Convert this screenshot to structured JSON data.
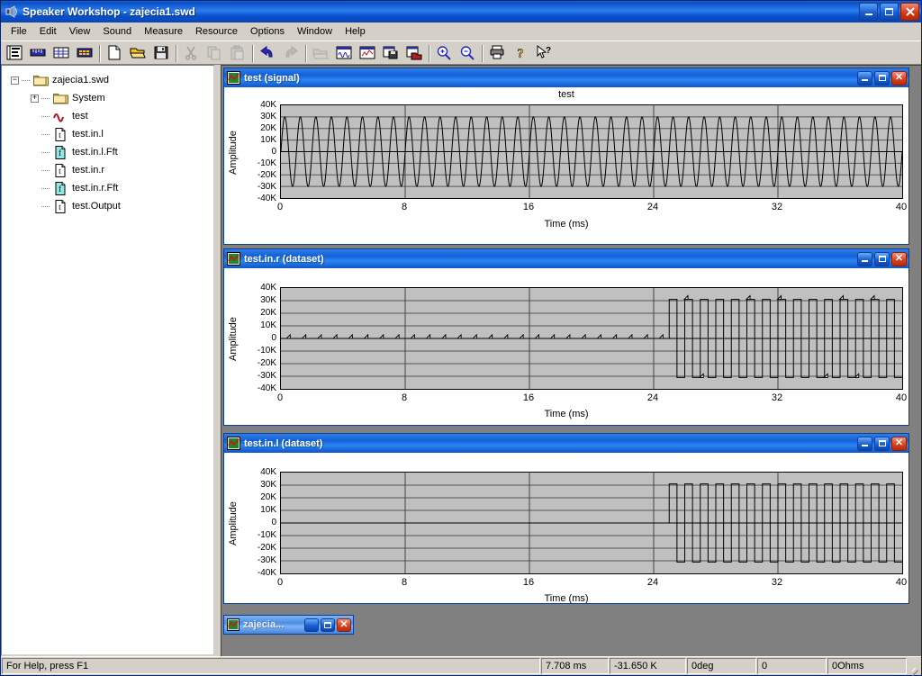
{
  "window": {
    "title": "Speaker Workshop - zajecia1.swd",
    "app_icon": "speaker-icon",
    "buttons": {
      "minimize": "minimize",
      "maximize": "maximize",
      "close": "close"
    }
  },
  "menu": {
    "items": [
      "File",
      "Edit",
      "View",
      "Sound",
      "Measure",
      "Resource",
      "Options",
      "Window",
      "Help"
    ]
  },
  "toolbar": {
    "groups": [
      {
        "buttons": [
          {
            "name": "project-view-icon",
            "enabled": true
          },
          {
            "name": "ruler-icon",
            "enabled": true
          },
          {
            "name": "grid-icon",
            "enabled": true
          },
          {
            "name": "keypad-icon",
            "enabled": true
          }
        ]
      },
      {
        "buttons": [
          {
            "name": "new-file-icon",
            "enabled": true
          },
          {
            "name": "open-folder-icon",
            "enabled": true
          },
          {
            "name": "save-disk-icon",
            "enabled": true
          }
        ]
      },
      {
        "buttons": [
          {
            "name": "cut-scissors-icon",
            "enabled": false
          },
          {
            "name": "copy-icon",
            "enabled": false
          },
          {
            "name": "paste-icon",
            "enabled": false
          }
        ]
      },
      {
        "buttons": [
          {
            "name": "undo-arrow-icon",
            "enabled": true
          },
          {
            "name": "redo-arrow-icon",
            "enabled": false
          }
        ]
      },
      {
        "buttons": [
          {
            "name": "import-icon",
            "enabled": false
          },
          {
            "name": "signal-window-icon",
            "enabled": true
          },
          {
            "name": "chart-window-icon",
            "enabled": true
          },
          {
            "name": "save-data-icon",
            "enabled": true
          },
          {
            "name": "load-data-icon",
            "enabled": true
          }
        ]
      },
      {
        "buttons": [
          {
            "name": "zoom-in-icon",
            "enabled": true
          },
          {
            "name": "zoom-out-icon",
            "enabled": true
          }
        ]
      },
      {
        "buttons": [
          {
            "name": "print-icon",
            "enabled": true
          },
          {
            "name": "help-question-icon",
            "enabled": true
          },
          {
            "name": "context-help-icon",
            "enabled": true
          }
        ]
      }
    ]
  },
  "tree": {
    "nodes": [
      {
        "label": "zajecia1.swd",
        "depth": 0,
        "expander": "-",
        "icon": "folder-open-icon"
      },
      {
        "label": "System",
        "depth": 1,
        "expander": "+",
        "icon": "folder-icon"
      },
      {
        "label": "test",
        "depth": 1,
        "expander": "",
        "icon": "waveform-icon"
      },
      {
        "label": "test.in.l",
        "depth": 1,
        "expander": "",
        "icon": "t-document-icon"
      },
      {
        "label": "test.in.l.Fft",
        "depth": 1,
        "expander": "",
        "icon": "f-document-icon"
      },
      {
        "label": "test.in.r",
        "depth": 1,
        "expander": "",
        "icon": "t-document-icon"
      },
      {
        "label": "test.in.r.Fft",
        "depth": 1,
        "expander": "",
        "icon": "f-document-icon"
      },
      {
        "label": "test.Output",
        "depth": 1,
        "expander": "",
        "icon": "t-document-icon"
      }
    ]
  },
  "mdi_windows": [
    {
      "title": "test (signal)",
      "icon": "chart-doc-icon",
      "buttons": {
        "minimize": "minimize",
        "maximize": "maximize",
        "close": "close"
      }
    },
    {
      "title": "test.in.r (dataset)",
      "icon": "chart-doc-icon",
      "buttons": {
        "minimize": "minimize",
        "maximize": "maximize",
        "close": "close"
      }
    },
    {
      "title": "test.in.l (dataset)",
      "icon": "chart-doc-icon",
      "buttons": {
        "minimize": "minimize",
        "maximize": "maximize",
        "close": "close"
      }
    }
  ],
  "minimized_window": {
    "title": "zajecia...",
    "icon": "chart-doc-icon",
    "buttons": {
      "restore": "restore",
      "maximize": "maximize",
      "close": "close"
    }
  },
  "statusbar": {
    "help_text": "For Help, press F1",
    "panels": [
      "7.708  ms",
      "-31.650 K",
      "0deg",
      "0",
      "0Ohms"
    ]
  },
  "chart_data": [
    {
      "type": "line",
      "title": "test",
      "xlabel": "Time (ms)",
      "ylabel": "Amplitude",
      "xticks": [
        0,
        8,
        16,
        24,
        32,
        40
      ],
      "xticklabels": [
        "0",
        "8",
        "16",
        "24",
        "32",
        "40"
      ],
      "yticks": [
        40000,
        30000,
        20000,
        10000,
        0,
        -10000,
        -20000,
        -30000,
        -40000
      ],
      "yticklabels": [
        "40K",
        "30K",
        "20K",
        "10K",
        "0",
        "-10K",
        "-20K",
        "-30K",
        "-40K"
      ],
      "xlim": [
        0,
        40
      ],
      "ylim": [
        -40000,
        40000
      ],
      "grid": true,
      "series": [
        {
          "name": "test",
          "waveform": "sine",
          "frequency_khz": 1.0,
          "amplitude": 30000,
          "offset": 0,
          "start_ms": 0,
          "end_ms": 40,
          "markers": false
        }
      ]
    },
    {
      "type": "line",
      "title": "",
      "xlabel": "Time (ms)",
      "ylabel": "Amplitude",
      "xticks": [
        0,
        8,
        16,
        24,
        32,
        40
      ],
      "xticklabels": [
        "0",
        "8",
        "16",
        "24",
        "32",
        "40"
      ],
      "yticks": [
        40000,
        30000,
        20000,
        10000,
        0,
        -10000,
        -20000,
        -30000,
        -40000
      ],
      "yticklabels": [
        "40K",
        "30K",
        "20K",
        "10K",
        "0",
        "-10K",
        "-20K",
        "-30K",
        "-40K"
      ],
      "xlim": [
        0,
        40
      ],
      "ylim": [
        -40000,
        40000
      ],
      "grid": true,
      "series": [
        {
          "name": "test.in.r",
          "waveform": "silence-then-square",
          "silence_value": 0,
          "silence_start_ms": 0,
          "silence_end_ms": 25,
          "square_start_ms": 25,
          "square_end_ms": 40,
          "frequency_khz": 1.0,
          "amplitude": 31000,
          "markers": true,
          "marker_shape": "diamond",
          "marker_interval_ms": 1.0
        }
      ]
    },
    {
      "type": "line",
      "title": "",
      "xlabel": "Time (ms)",
      "ylabel": "Amplitude",
      "xticks": [
        0,
        8,
        16,
        24,
        32,
        40
      ],
      "xticklabels": [
        "0",
        "8",
        "16",
        "24",
        "32",
        "40"
      ],
      "yticks": [
        40000,
        30000,
        20000,
        10000,
        0,
        -10000,
        -20000,
        -30000,
        -40000
      ],
      "yticklabels": [
        "40K",
        "30K",
        "20K",
        "10K",
        "0",
        "-10K",
        "-20K",
        "-30K",
        "-40K"
      ],
      "xlim": [
        0,
        40
      ],
      "ylim": [
        -40000,
        40000
      ],
      "grid": true,
      "series": [
        {
          "name": "test.in.l",
          "waveform": "silence-then-square",
          "silence_value": 0,
          "silence_start_ms": 0,
          "silence_end_ms": 25,
          "square_start_ms": 25,
          "square_end_ms": 40,
          "frequency_khz": 1.0,
          "amplitude": 31000,
          "markers": false
        }
      ]
    }
  ]
}
